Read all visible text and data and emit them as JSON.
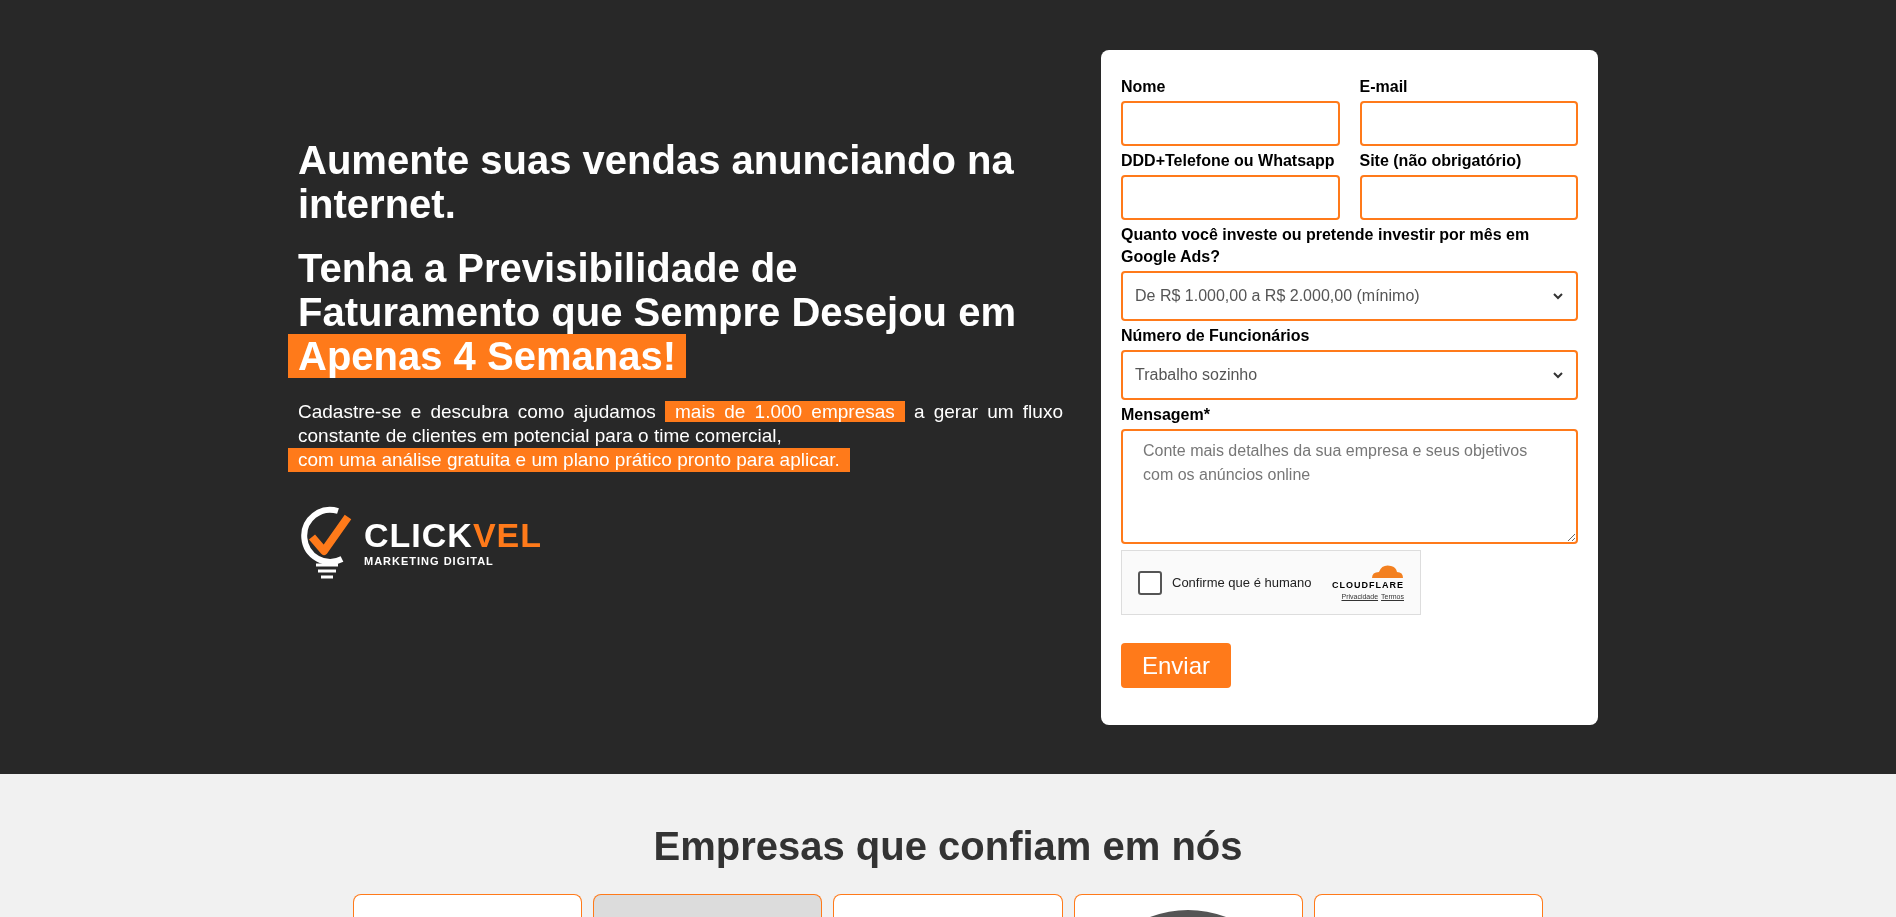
{
  "hero": {
    "headline": "Aumente suas vendas anunciando na internet.",
    "subheadline": "Tenha a Previsibilidade de Faturamento que Sempre Desejou em",
    "subheadline_highlight": "Apenas 4 Semanas!",
    "paragraph_start": "Cadastre-se e descubra como ajudamos",
    "paragraph_highlight": "mais de 1.000 empresas",
    "paragraph_end": "a gerar um fluxo constante de clientes em potencial para o time comercial,",
    "paragraph_highlight_2": "com uma análise gratuita e um plano prático pronto para aplicar.",
    "logo": {
      "name": "CLICK",
      "name_accent": "VEL",
      "tagline": "MARKETING DIGITAL"
    }
  },
  "form": {
    "fields": [
      {
        "kind": "input",
        "label": "Nome"
      },
      {
        "kind": "input",
        "label": "E-mail"
      },
      {
        "kind": "input",
        "label": "DDD+Telefone ou Whatsapp"
      },
      {
        "kind": "input",
        "label": "Site (não obrigatório)"
      },
      {
        "kind": "select",
        "label": "Quanto você investe ou pretende investir por mês em Google Ads?",
        "value": "De R$ 1.000,00 a R$ 2.000,00 (mínimo)"
      },
      {
        "kind": "select",
        "label": "Número de Funcionários",
        "value": "Trabalho sozinho"
      },
      {
        "kind": "textarea",
        "label": "Mensagem*",
        "placeholder": "Conte mais detalhes da sua empresa e seus objetivos com os anúncios online"
      }
    ],
    "captcha": {
      "label": "Confirme que é humano",
      "checked": false,
      "brand": "CLOUDFLARE",
      "links": [
        "Privacidade",
        "Termos"
      ]
    },
    "submit": "Enviar"
  },
  "clients": {
    "title": "Empresas que confiam em nós"
  }
}
